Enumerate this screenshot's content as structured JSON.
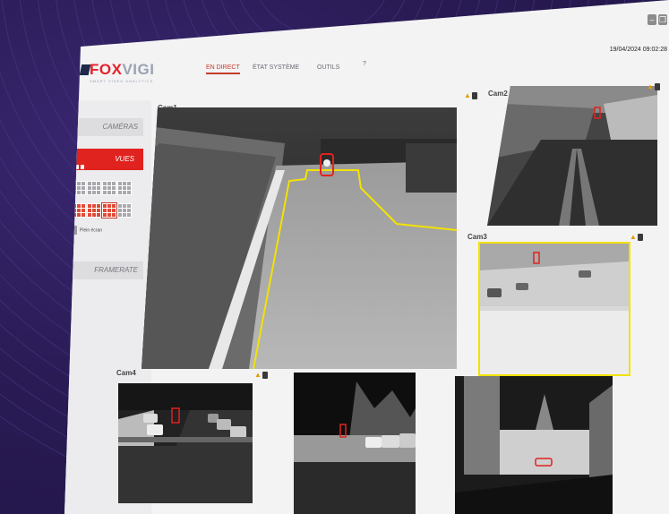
{
  "app": {
    "logo_prefix": "FOX",
    "logo_suffix": "VIGI",
    "tagline": "SMART VIDEO ANALYTICS"
  },
  "nav": {
    "items": [
      "EN DIRECT",
      "ÉTAT SYSTÈME",
      "OUTILS",
      "?"
    ],
    "active": "EN DIRECT"
  },
  "datetime": "19/04/2024  09:02:28",
  "sidebar": {
    "cameras_label": "CAMÉRAS",
    "views_label": "VUES",
    "fullscreen_label": "Plein écran",
    "framerate_label": "FRAMERATE"
  },
  "cameras": [
    {
      "label": "Cam1"
    },
    {
      "label": "Cam2"
    },
    {
      "label": "Cam3"
    },
    {
      "label": "Cam4"
    },
    {
      "label": ""
    },
    {
      "label": ""
    }
  ],
  "colors": {
    "accent": "#e0231f",
    "detection_zone": "#f2e200",
    "detection_box": "#e0231f",
    "warning": "#e79b00"
  },
  "icons": {
    "alert": "warning-triangle-icon",
    "camera": "camera-icon",
    "minimize": "minimize-icon",
    "restore": "restore-icon"
  }
}
